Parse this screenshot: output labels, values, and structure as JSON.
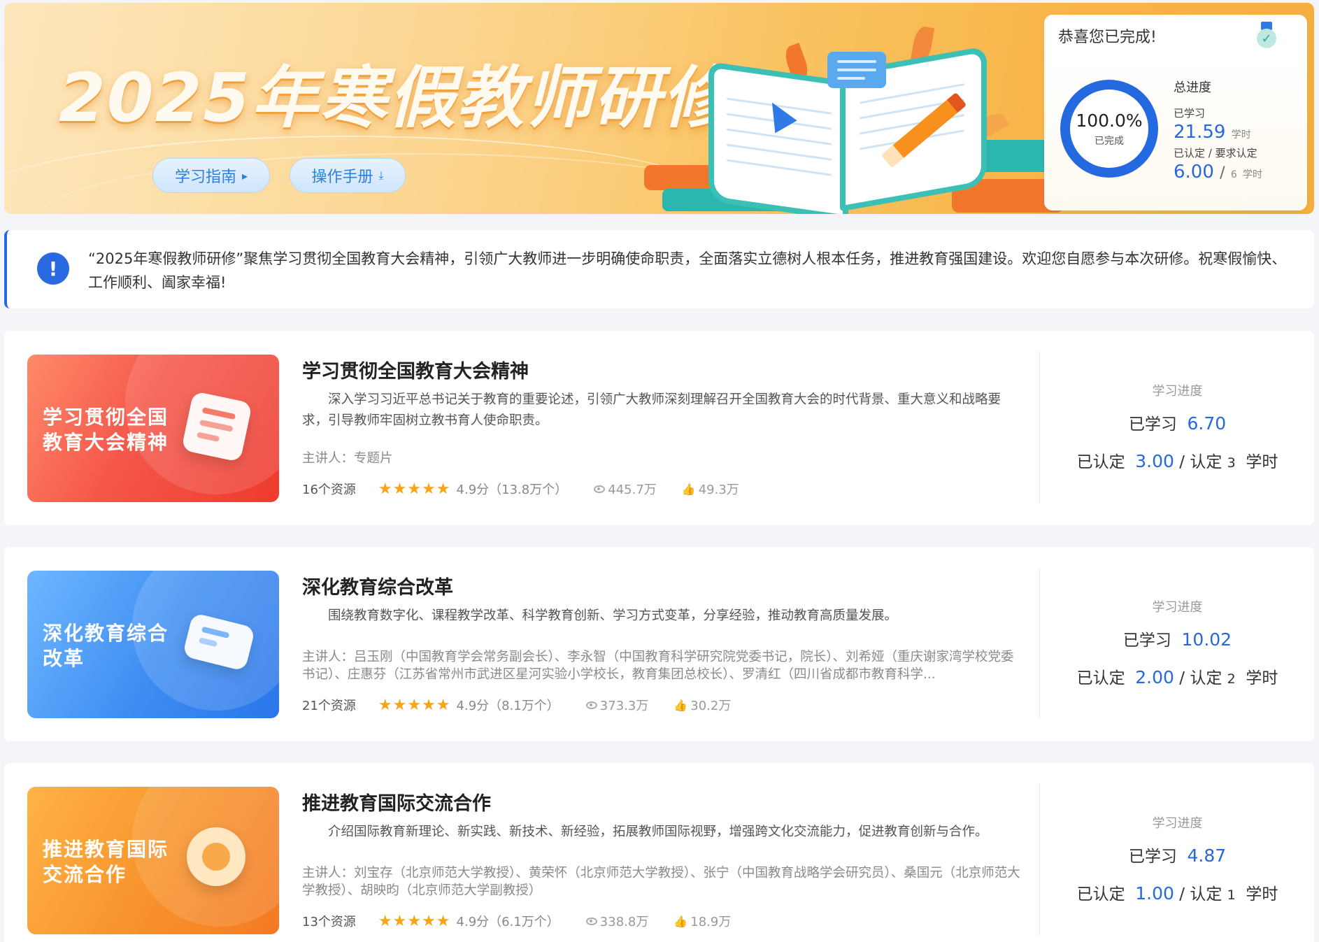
{
  "banner": {
    "title": "2025年寒假教师研修",
    "guide_label": "学习指南",
    "manual_label": "操作手册"
  },
  "progress": {
    "congrats": "恭喜您已完成!",
    "percent_text": "100.0%",
    "percent_value": 100.0,
    "completed_label": "已完成",
    "total_label": "总进度",
    "studied_label": "已学习",
    "studied_value": "21.59",
    "unit": "学时",
    "credited_label": "已认定 / 要求认定",
    "credited_value": "6.00",
    "required_value": "6"
  },
  "notice": {
    "text": "“2025年寒假教师研修”聚焦学习贯彻全国教育大会精神，引领广大教师进一步明确使命职责，全面落实立德树人根本任务，推进教育强国建设。欢迎您自愿参与本次研修。祝寒假愉快、工作顺利、阖家幸福!"
  },
  "labels": {
    "progress_label": "学习进度",
    "studied_prefix": "已学习",
    "credited_prefix": "已认定",
    "credit_req_prefix": "认定",
    "unit": "学时"
  },
  "courses": [
    {
      "thumb_text": "学习贯彻全国教育大会精神",
      "title": "学习贯彻全国教育大会精神",
      "desc": "深入学习习近平总书记关于教育的重要论述，引领广大教师深刻理解召开全国教育大会的时代背景、重大意义和战略要求，引导教师牢固树立教书育人使命职责。",
      "lecturer": "主讲人：专题片",
      "resources": "16个资源",
      "rating": "4.9分（13.8万个）",
      "views": "445.7万",
      "likes": "49.3万",
      "studied": "6.70",
      "credited": "3.00",
      "required": "3"
    },
    {
      "thumb_text": "深化教育综合改革",
      "title": "深化教育综合改革",
      "desc": "围绕教育数字化、课程教学改革、科学教育创新、学习方式变革，分享经验，推动教育高质量发展。",
      "lecturer": "主讲人：吕玉刚（中国教育学会常务副会长）、李永智（中国教育科学研究院党委书记，院长）、刘希娅（重庆谢家湾学校党委书记）、庄惠芬（江苏省常州市武进区星河实验小学校长，教育集团总校长）、罗清红（四川省成都市教育科学...",
      "resources": "21个资源",
      "rating": "4.9分（8.1万个）",
      "views": "373.3万",
      "likes": "30.2万",
      "studied": "10.02",
      "credited": "2.00",
      "required": "2"
    },
    {
      "thumb_text": "推进教育国际交流合作",
      "title": "推进教育国际交流合作",
      "desc": "介绍国际教育新理论、新实践、新技术、新经验，拓展教师国际视野，增强跨文化交流能力，促进教育创新与合作。",
      "lecturer": "主讲人：刘宝存（北京师范大学教授）、黄荣怀（北京师范大学教授）、张宁（中国教育战略学会研究员）、桑国元（北京师范大学教授）、胡映昀（北京师范大学副教授）",
      "resources": "13个资源",
      "rating": "4.9分（6.1万个）",
      "views": "338.8万",
      "likes": "18.9万",
      "studied": "4.87",
      "credited": "1.00",
      "required": "1"
    }
  ],
  "colors": {
    "accent": "#2469e0",
    "thumb_red": "#f24e3a",
    "thumb_blue": "#3d8df2",
    "thumb_orange": "#f6902b",
    "star": "#f7a416"
  }
}
